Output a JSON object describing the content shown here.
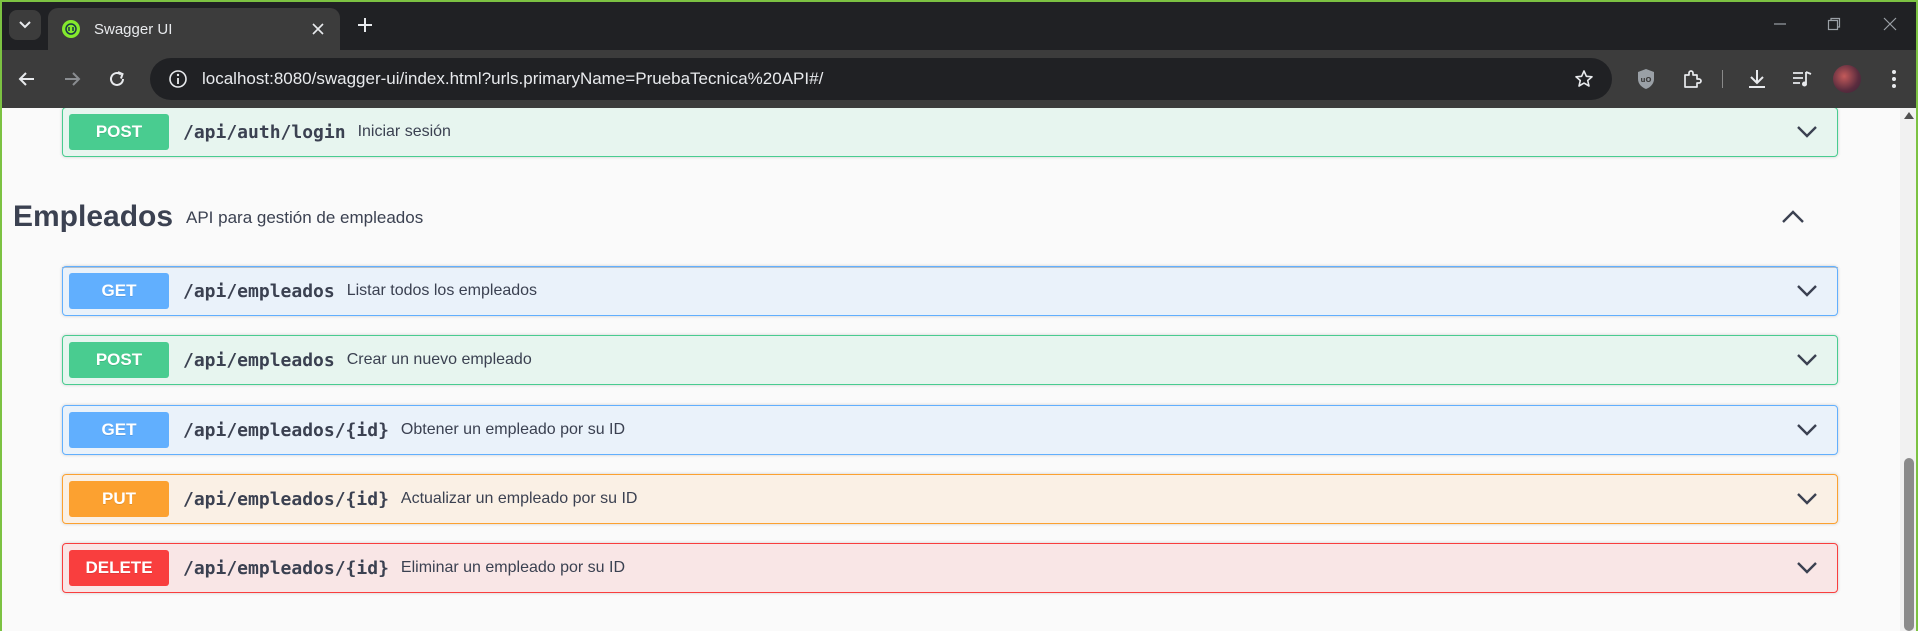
{
  "browser": {
    "tab_title": "Swagger UI",
    "url": "localhost:8080/swagger-ui/index.html?urls.primaryName=PruebaTecnica%20API#/",
    "icons": [
      "tab-search-icon",
      "swagger-favicon",
      "close-icon",
      "plus-icon",
      "minimize-icon",
      "restore-icon",
      "close-window-icon",
      "back-arrow-icon",
      "forward-arrow-icon",
      "reload-icon",
      "site-info-icon",
      "star-icon",
      "ublock-shield-icon",
      "extensions-puzzle-icon",
      "download-icon",
      "media-queue-icon",
      "profile-avatar",
      "kebab-menu-icon"
    ]
  },
  "top_operation": {
    "method": "POST",
    "path": "/api/auth/login",
    "summary": "Iniciar sesión"
  },
  "tag": {
    "name": "Empleados",
    "description": "API para gestión de empleados",
    "expanded": true
  },
  "operations": [
    {
      "method": "GET",
      "path": "/api/empleados",
      "summary": "Listar todos los empleados"
    },
    {
      "method": "POST",
      "path": "/api/empleados",
      "summary": "Crear un nuevo empleado"
    },
    {
      "method": "GET",
      "path": "/api/empleados/{id}",
      "summary": "Obtener un empleado por su ID"
    },
    {
      "method": "PUT",
      "path": "/api/empleados/{id}",
      "summary": "Actualizar un empleado por su ID"
    },
    {
      "method": "DELETE",
      "path": "/api/empleados/{id}",
      "summary": "Eliminar un empleado por su ID"
    }
  ],
  "colors": {
    "post": "#49cc90",
    "get": "#61affe",
    "put": "#fca130",
    "delete": "#f93e3e",
    "text": "#3b4151",
    "window_accent": "#7cc242"
  }
}
